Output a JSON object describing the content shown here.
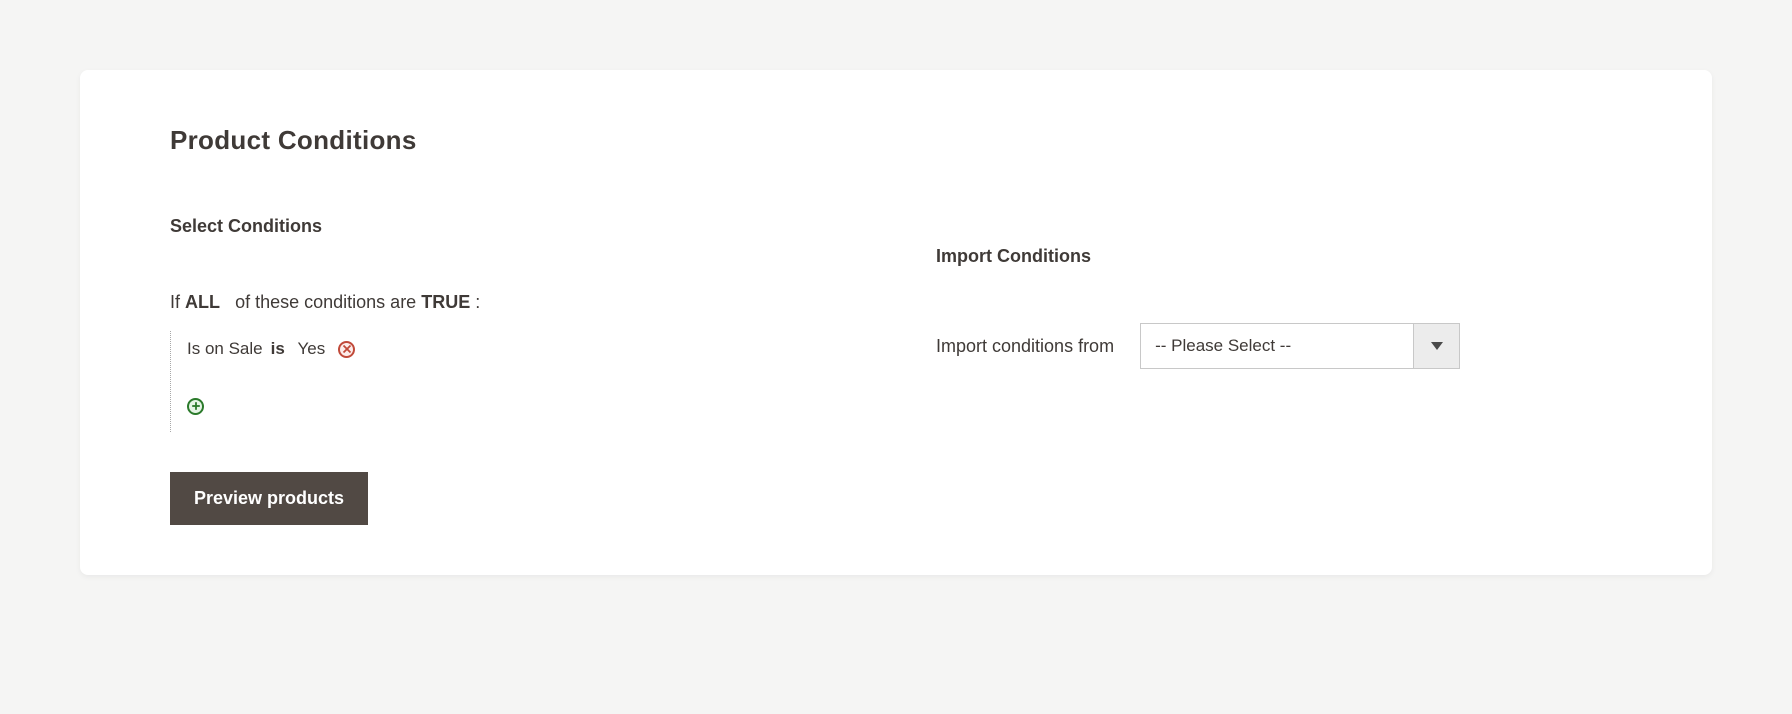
{
  "section": {
    "title": "Product Conditions"
  },
  "select_conditions": {
    "title": "Select Conditions",
    "rule_prefix": "If",
    "rule_aggregator": "ALL",
    "rule_mid": "of these conditions are",
    "rule_value": "TRUE",
    "rule_suffix": ":",
    "conditions": [
      {
        "attribute": "Is on Sale",
        "operator": "is",
        "value": "Yes"
      }
    ],
    "preview_label": "Preview products"
  },
  "import_conditions": {
    "title": "Import Conditions",
    "label": "Import conditions from",
    "selected": "-- Please Select --"
  }
}
